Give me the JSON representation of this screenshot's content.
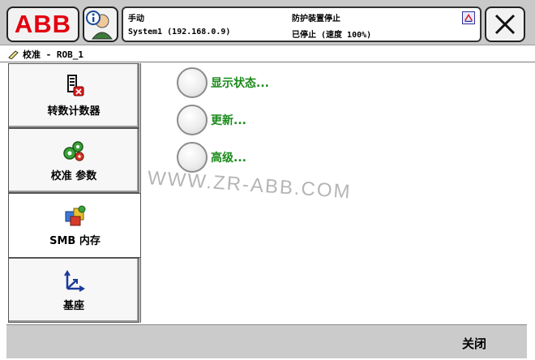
{
  "header": {
    "logo_text": "ABB",
    "mode": "手动",
    "system": "System1 (192.168.0.9)",
    "guard_status": "防护装置停止",
    "run_state": "已停止 (速度 100%)",
    "close_icon": "x-icon",
    "info_icon": "user-info-icon"
  },
  "title_bar": {
    "title": "校准 - ROB_1",
    "icon": "calibration-icon"
  },
  "sidebar": {
    "items": [
      {
        "label": "转数计数器",
        "icon": "revolution-counter-icon",
        "selected": false
      },
      {
        "label": "校准 参数",
        "icon": "calibration-parameters-icon",
        "selected": false
      },
      {
        "label": "SMB 内存",
        "icon": "smb-memory-icon",
        "selected": true
      },
      {
        "label": "基座",
        "icon": "base-frame-icon",
        "selected": false
      }
    ]
  },
  "main": {
    "options": [
      {
        "label": "显示状态..."
      },
      {
        "label": "更新..."
      },
      {
        "label": "高级..."
      }
    ]
  },
  "watermark": "WWW.ZR-ABB.COM",
  "footer": {
    "close_label": "关闭"
  },
  "colors": {
    "abb_red": "#e2000f",
    "option_green": "#1a8a1a",
    "bar_gray": "#c9c9c9"
  }
}
